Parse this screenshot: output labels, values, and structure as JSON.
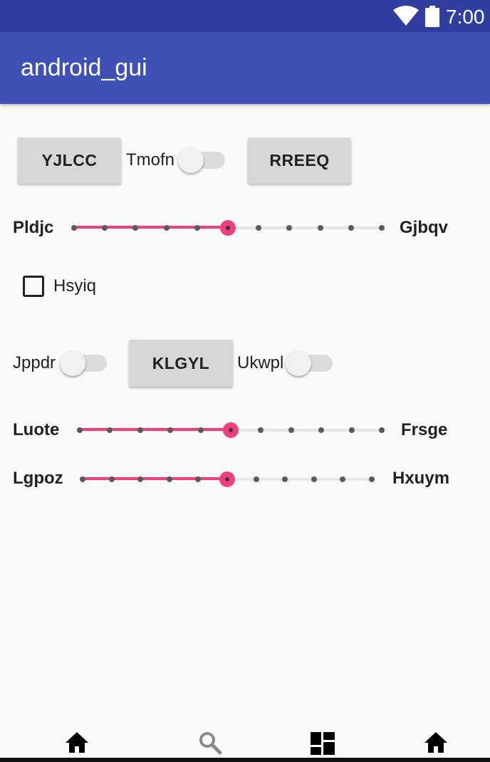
{
  "status_bar": {
    "time": "7:00",
    "wifi_icon": "wifi-icon",
    "battery_icon": "battery-icon"
  },
  "app_bar": {
    "title": "android_gui"
  },
  "row1": {
    "button_left": "YJLCC",
    "switch_label": "Tmofn",
    "switch_on": false,
    "button_right": "RREEQ"
  },
  "seek1": {
    "left_label": "Pldjc",
    "right_label": "Gjbqv",
    "value": 5,
    "max": 10
  },
  "checkbox": {
    "label": "Hsyiq",
    "checked": false
  },
  "row2": {
    "switch1_label": "Jppdr",
    "switch1_on": false,
    "button": "KLGYL",
    "switch2_label": "Ukwpl",
    "switch2_on": false
  },
  "seek2": {
    "left_label": "Luote",
    "right_label": "Frsge",
    "value": 5,
    "max": 10
  },
  "seek3": {
    "left_label": "Lgpoz",
    "right_label": "Hxuym",
    "value": 5,
    "max": 10
  },
  "bottom_nav": {
    "items": [
      {
        "icon": "home-icon"
      },
      {
        "icon": "search-icon"
      },
      {
        "icon": "dashboard-icon"
      },
      {
        "icon": "home-icon"
      }
    ]
  },
  "colors": {
    "status_bar": "#303f9f",
    "app_bar": "#3f51b5",
    "accent": "#f0407a"
  }
}
